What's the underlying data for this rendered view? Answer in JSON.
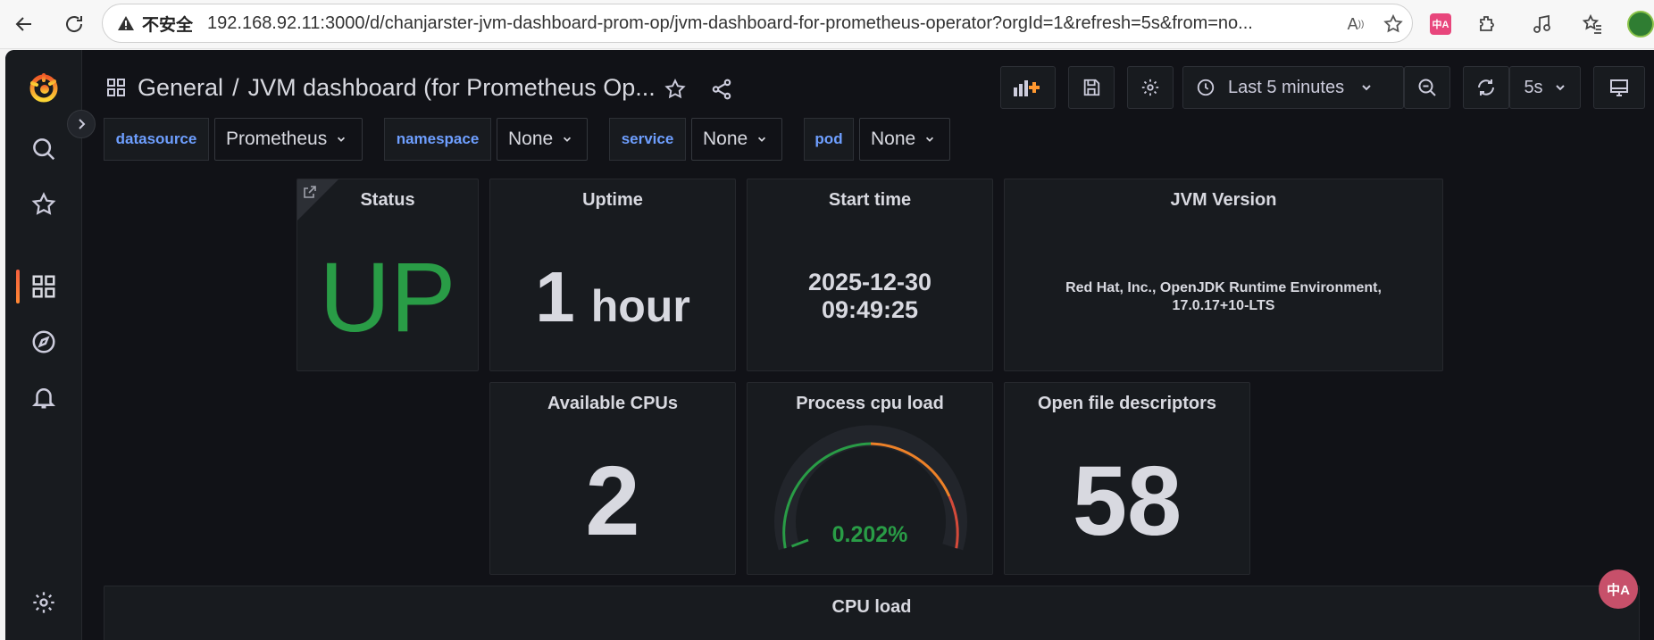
{
  "browser": {
    "insecure_label": "不安全",
    "url": "192.168.92.11:3000/d/chanjarster-jvm-dashboard-prom-op/jvm-dashboard-for-prometheus-operator?orgId=1&refresh=5s&from=no..."
  },
  "breadcrumb": {
    "folder": "General",
    "separator": "/",
    "dashboard": "JVM dashboard (for Prometheus Op..."
  },
  "toolbar": {
    "time_range": "Last 5 minutes",
    "refresh_interval": "5s"
  },
  "variables": [
    {
      "label": "datasource",
      "value": "Prometheus"
    },
    {
      "label": "namespace",
      "value": "None"
    },
    {
      "label": "service",
      "value": "None"
    },
    {
      "label": "pod",
      "value": "None"
    }
  ],
  "panels": {
    "status": {
      "title": "Status",
      "value": "UP",
      "color": "#299c46"
    },
    "uptime": {
      "title": "Uptime",
      "value": "1",
      "unit": "hour"
    },
    "start_time": {
      "title": "Start time",
      "date": "2025-12-30",
      "time": "09:49:25"
    },
    "jvm_version": {
      "title": "JVM Version",
      "value": "Red Hat, Inc., OpenJDK Runtime Environment, 17.0.17+10-LTS"
    },
    "available_cpus": {
      "title": "Available CPUs",
      "value": "2"
    },
    "process_cpu_load": {
      "title": "Process cpu load",
      "value": "0.202%",
      "percent": 0.202,
      "threshold_colors": [
        "#299c46",
        "#ed8128",
        "#d44a3a"
      ]
    },
    "open_fds": {
      "title": "Open file descriptors",
      "value": "58"
    },
    "cpu_load": {
      "title": "CPU load"
    }
  },
  "colors": {
    "background": "#111217",
    "panel": "#181b1f",
    "accent_blue": "#6e9fff",
    "ok_green": "#299c46",
    "grafana_orange": "#f55f3e"
  },
  "extensions": {
    "translate_badge": "中A"
  }
}
